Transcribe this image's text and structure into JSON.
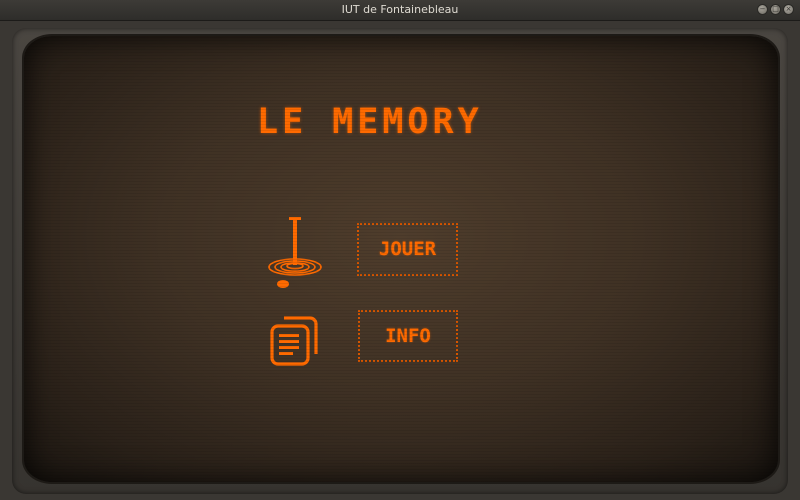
{
  "window": {
    "title": "IUT de Fontainebleau",
    "controls": {
      "minimize": "−",
      "maximize": "□",
      "close": "×"
    }
  },
  "menu": {
    "logo": "LE MEMORY",
    "play_label": "JOUER",
    "info_label": "INFO",
    "play_icon": "joystick-icon",
    "info_icon": "documents-icon"
  },
  "colors": {
    "accent": "#ff6a00",
    "screen": "#3f3124",
    "bezel": "#4a4641"
  }
}
